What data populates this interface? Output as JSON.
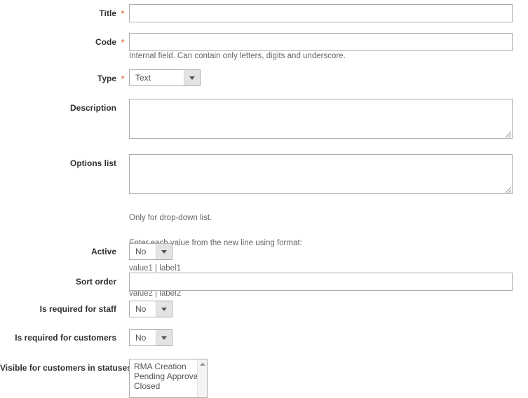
{
  "form": {
    "required_marker": "*",
    "accent_required_color": "#e04f1a",
    "fields": [
      {
        "key": "title",
        "label": "Title",
        "required": true,
        "control": "text",
        "value": "",
        "placeholder": ""
      },
      {
        "key": "code",
        "label": "Code",
        "required": true,
        "control": "text",
        "value": "",
        "placeholder": "",
        "note": "Internal field. Can contain only letters, digits and underscore."
      },
      {
        "key": "type",
        "label": "Type",
        "required": true,
        "control": "select",
        "value": "Text"
      },
      {
        "key": "description",
        "label": "Description",
        "required": false,
        "control": "textarea",
        "value": "",
        "placeholder": ""
      },
      {
        "key": "options_list",
        "label": "Options list",
        "required": false,
        "control": "textarea",
        "value": "",
        "placeholder": "",
        "note_lines": [
          "Only for drop-down list.",
          "Enter each value from the new line using format:",
          "value1 | label1",
          "value2 | label2"
        ]
      },
      {
        "key": "active",
        "label": "Active",
        "required": false,
        "control": "select",
        "value": "No"
      },
      {
        "key": "sort_order",
        "label": "Sort order",
        "required": false,
        "control": "text",
        "value": "",
        "placeholder": ""
      },
      {
        "key": "is_required_for_staff",
        "label": "Is required for staff",
        "required": false,
        "control": "select",
        "value": "No"
      },
      {
        "key": "is_required_for_customers",
        "label": "Is required for customers",
        "required": false,
        "control": "select",
        "value": "No"
      },
      {
        "key": "visible_for_customers_in_statuses",
        "label": "Visible for customers in statuses",
        "required": false,
        "control": "multiselect",
        "options": [
          "RMA Creation",
          "Pending Approval",
          "Closed"
        ]
      }
    ]
  }
}
